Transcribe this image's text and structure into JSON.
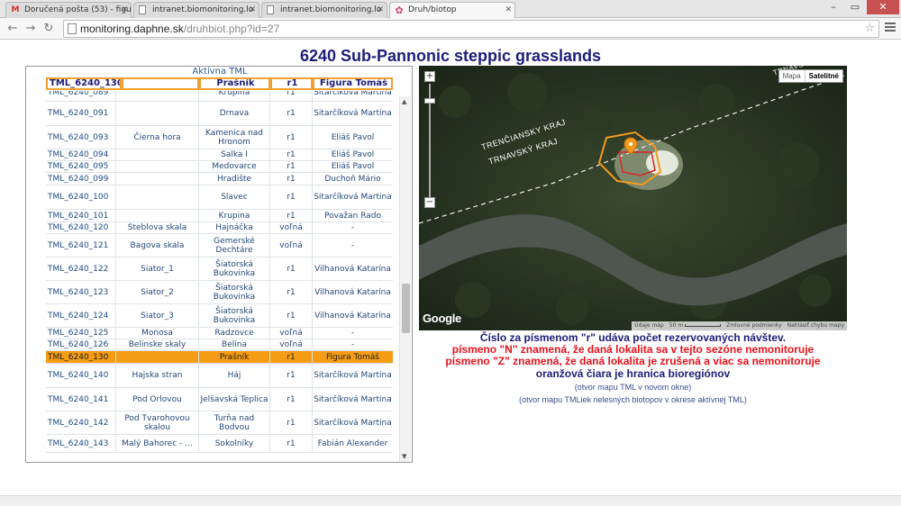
{
  "browser": {
    "tabs": [
      {
        "title": "Doručená pošta (53) - figu",
        "icon": "gmail-icon",
        "color": "#d93025",
        "active": false
      },
      {
        "title": "intranet.biomonitoring.lo",
        "icon": "page-icon",
        "color": "#888888",
        "active": false
      },
      {
        "title": "intranet.biomonitoring.lo",
        "icon": "page-icon",
        "color": "#888888",
        "active": false
      },
      {
        "title": "Druh/biotop",
        "icon": "flower-icon",
        "color": "#e0406a",
        "active": true
      }
    ],
    "url_host": "monitoring.daphne.sk",
    "url_path": "/druhbiot.php?id=27"
  },
  "page": {
    "title": "6240 Sub-Pannonic steppic grasslands",
    "active_label": "Aktívna TML",
    "header": {
      "code": "TML_6240_130",
      "name": "",
      "locality": "Prašník",
      "reservations": "r1",
      "person": "Figura Tomáš"
    },
    "rows": [
      {
        "code": "TML_6240_089",
        "name": "",
        "locality": "Krupina",
        "res": "r1",
        "person": "Sitarčíková Martina",
        "highlight": false
      },
      {
        "code": "TML_6240_091",
        "name": "",
        "locality": "Drnava",
        "res": "r1",
        "person": "Sitarčíková Martina",
        "highlight": false
      },
      {
        "code": "TML_6240_093",
        "name": "Čierna hora",
        "locality": "Kamenica nad Hronom",
        "res": "r1",
        "person": "Eliáš Pavol",
        "highlight": false
      },
      {
        "code": "TML_6240_094",
        "name": "",
        "locality": "Salka I",
        "res": "r1",
        "person": "Eliáš Pavol",
        "highlight": false
      },
      {
        "code": "TML_6240_095",
        "name": "",
        "locality": "Medovarce",
        "res": "r1",
        "person": "Eliáš Pavol",
        "highlight": false
      },
      {
        "code": "TML_6240_099",
        "name": "",
        "locality": "Hradište",
        "res": "r1",
        "person": "Duchoň Mário",
        "highlight": false
      },
      {
        "code": "TML_6240_100",
        "name": "",
        "locality": "Slavec",
        "res": "r1",
        "person": "Sitarčíková Martina",
        "highlight": false
      },
      {
        "code": "TML_6240_101",
        "name": "",
        "locality": "Krupina",
        "res": "r1",
        "person": "Považan Rado",
        "highlight": false
      },
      {
        "code": "TML_6240_120",
        "name": "Steblova skala",
        "locality": "Hajnáčka",
        "res": "voľná",
        "person": "-",
        "highlight": false
      },
      {
        "code": "TML_6240_121",
        "name": "Bagova skala",
        "locality": "Gemerské Dechtáre",
        "res": "voľná",
        "person": "-",
        "highlight": false
      },
      {
        "code": "TML_6240_122",
        "name": "Siator_1",
        "locality": "Šiatorská Bukovinka",
        "res": "r1",
        "person": "Vilhanová Katarína",
        "highlight": false
      },
      {
        "code": "TML_6240_123",
        "name": "Siator_2",
        "locality": "Šiatorská Bukovinka",
        "res": "r1",
        "person": "Vilhanová Katarína",
        "highlight": false
      },
      {
        "code": "TML_6240_124",
        "name": "Siator_3",
        "locality": "Šiatorská Bukovinka",
        "res": "r1",
        "person": "Vilhanová Katarína",
        "highlight": false
      },
      {
        "code": "TML_6240_125",
        "name": "Monosa",
        "locality": "Radzovce",
        "res": "voľná",
        "person": "-",
        "highlight": false
      },
      {
        "code": "TML_6240_126",
        "name": "Belinske skaly",
        "locality": "Belina",
        "res": "voľná",
        "person": "-",
        "highlight": false
      },
      {
        "code": "TML_6240_130",
        "name": "",
        "locality": "Prašník",
        "res": "r1",
        "person": "Figura Tomáš",
        "highlight": true
      },
      {
        "code": "TML_6240_140",
        "name": "Hajska stran",
        "locality": "Háj",
        "res": "r1",
        "person": "Sitarčíková Martina",
        "highlight": false
      },
      {
        "code": "TML_6240_141",
        "name": "Pod Orlovou",
        "locality": "Jelšavská Teplica",
        "res": "r1",
        "person": "Sitarčíková Martina",
        "highlight": false
      },
      {
        "code": "TML_6240_142",
        "name": "Pod Tvarohovou skalou",
        "locality": "Turňa nad Bodvou",
        "res": "r1",
        "person": "Sitarčíková Martina",
        "highlight": false
      },
      {
        "code": "TML_6240_143",
        "name": "Malý Bahorec - ...",
        "locality": "Sokolníky",
        "res": "r1",
        "person": "Fabián Alexander",
        "highlight": false
      }
    ]
  },
  "map": {
    "map_type_map": "Mapa",
    "map_type_satellite": "Satelitné",
    "zoom_in": "+",
    "zoom_out": "−",
    "google_label": "Google",
    "region_1": "TRENČIANSKY KRAJ",
    "region_2": "TRNAVSKÝ KRAJ",
    "region_top": "TRNAVSKÝ",
    "footer_data": "Údaje máp",
    "footer_scale": "50 m",
    "footer_terms": "Zmluvné podmienky",
    "footer_report": "Nahlásiť chybu mapy"
  },
  "info": {
    "line1": "Číslo za písmenom \"r\" udáva počet rezervovaných návštev.",
    "line2": "písmeno \"N\" znamená, že daná lokalita sa v tejto sezóne nemonitoruje",
    "line3": "písmeno \"Z\" znamená, že daná lokalita je zrušená a viac sa nemonitoruje",
    "line4": "oranžová čiara je hranica bioregiónov",
    "link1": "(otvor mapu TML v novom okne)",
    "link2": "(otvor mapu TMLiek nelesných biotopov v okrese aktívnej TML)"
  }
}
